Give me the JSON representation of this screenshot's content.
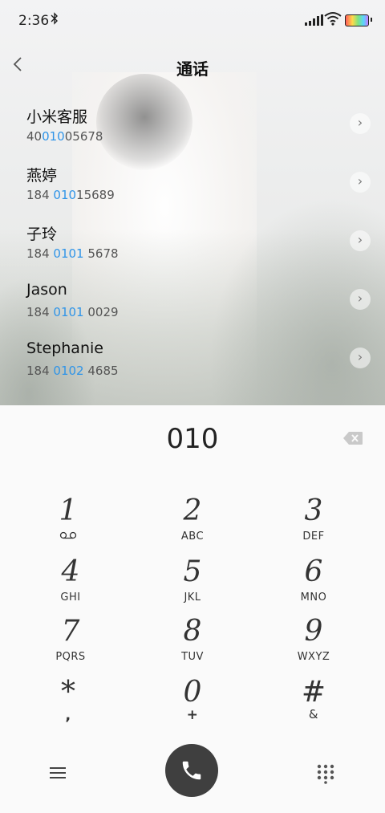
{
  "status_bar": {
    "time": "2:36",
    "bluetooth": "bluetooth-icon"
  },
  "header": {
    "title": "通话",
    "back": "chevron-left-icon"
  },
  "contacts": [
    {
      "name": "小米客服",
      "number_pre": "40",
      "number_hl": "010",
      "number_post": "05678"
    },
    {
      "name": "燕婷",
      "number_pre": "184 ",
      "number_hl": "010",
      "number_post": "15689"
    },
    {
      "name": "子玲",
      "number_pre": "184 ",
      "number_hl": "0101",
      "number_post": " 5678"
    },
    {
      "name": "Jason",
      "number_pre": "184 ",
      "number_hl": "0101",
      "number_post": " 0029"
    },
    {
      "name": "Stephanie",
      "number_pre": "184 ",
      "number_hl": "0102",
      "number_post": " 4685"
    }
  ],
  "dialer": {
    "entered": "010",
    "keys": [
      {
        "digit": "1",
        "letters": ""
      },
      {
        "digit": "2",
        "letters": "ABC"
      },
      {
        "digit": "3",
        "letters": "DEF"
      },
      {
        "digit": "4",
        "letters": "GHI"
      },
      {
        "digit": "5",
        "letters": "JKL"
      },
      {
        "digit": "6",
        "letters": "MNO"
      },
      {
        "digit": "7",
        "letters": "PQRS"
      },
      {
        "digit": "8",
        "letters": "TUV"
      },
      {
        "digit": "9",
        "letters": "WXYZ"
      },
      {
        "digit": "*",
        "letters": ","
      },
      {
        "digit": "0",
        "letters": "+"
      },
      {
        "digit": "#",
        "letters": "&"
      }
    ]
  },
  "colors": {
    "highlight": "#2f94e8",
    "call_button": "#3f3f3f"
  }
}
